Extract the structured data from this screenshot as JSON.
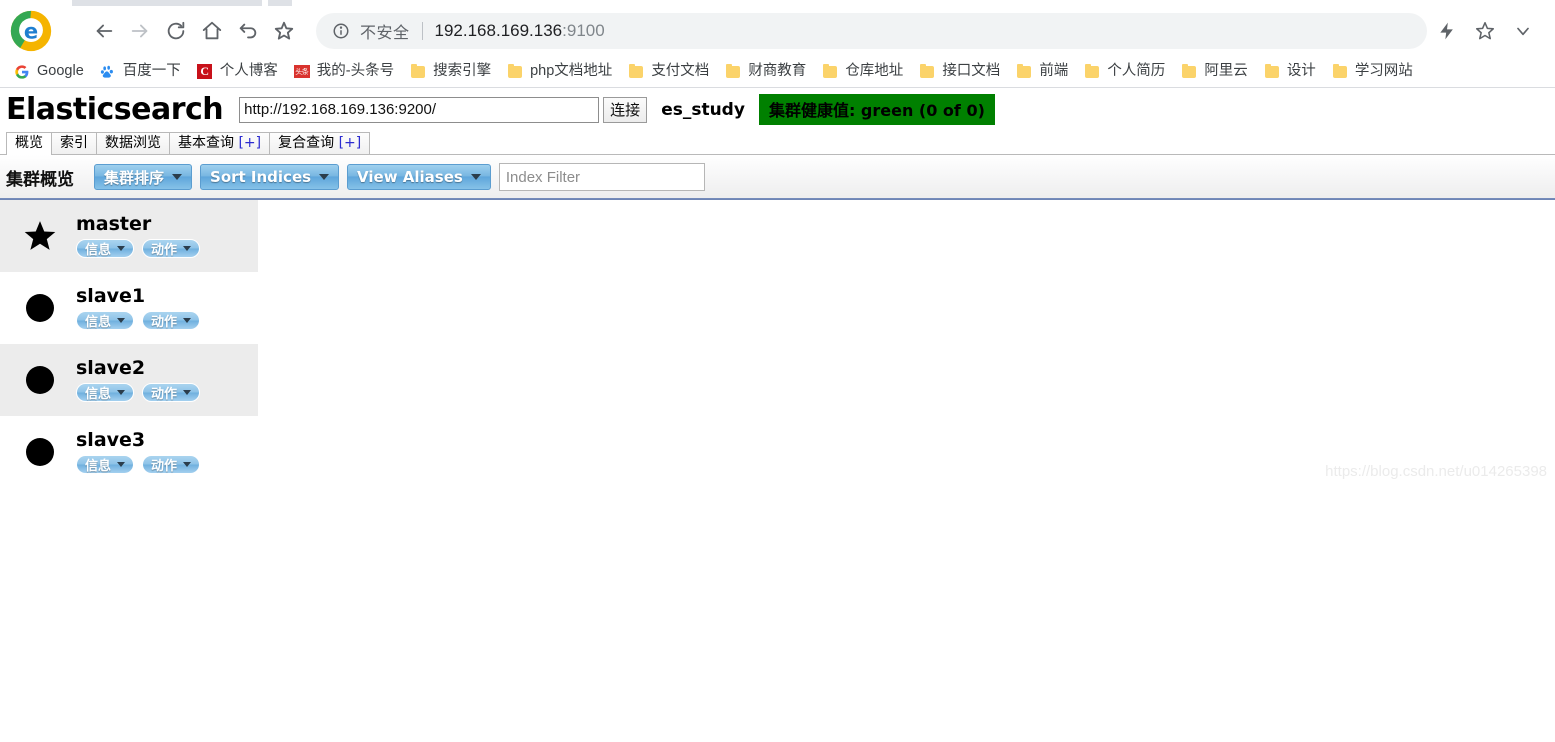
{
  "browser": {
    "nav": {
      "back_icon": "arrow-left-icon",
      "forward_icon": "arrow-right-icon",
      "reload_icon": "reload-icon",
      "home_icon": "home-icon",
      "history_back_icon": "undo-icon",
      "favorite_icon": "star-icon"
    },
    "omnibox": {
      "info_icon": "info-circle-icon",
      "security_label": "不安全",
      "url_host": "192.168.169.136",
      "url_port": ":9100"
    },
    "toolbar_right": {
      "flash_icon": "lightning-bolt-icon",
      "bookmark_icon": "star-outline-icon",
      "menu_icon": "chevron-down-icon"
    },
    "bookmarks": [
      {
        "label": "Google",
        "icon": "google-g-icon"
      },
      {
        "label": "百度一下",
        "icon": "baidu-paw-icon"
      },
      {
        "label": "个人博客",
        "icon": "csdn-c-icon"
      },
      {
        "label": "我的-头条号",
        "icon": "toutiao-icon"
      },
      {
        "label": "搜索引擎",
        "icon": "folder-icon"
      },
      {
        "label": "php文档地址",
        "icon": "folder-icon"
      },
      {
        "label": "支付文档",
        "icon": "folder-icon"
      },
      {
        "label": "财商教育",
        "icon": "folder-icon"
      },
      {
        "label": "仓库地址",
        "icon": "folder-icon"
      },
      {
        "label": "接口文档",
        "icon": "folder-icon"
      },
      {
        "label": "前端",
        "icon": "folder-icon"
      },
      {
        "label": "个人简历",
        "icon": "folder-icon"
      },
      {
        "label": "阿里云",
        "icon": "folder-icon"
      },
      {
        "label": "设计",
        "icon": "folder-icon"
      },
      {
        "label": "学习网站",
        "icon": "folder-icon"
      }
    ]
  },
  "app": {
    "title": "Elasticsearch",
    "connect": {
      "value": "http://192.168.169.136:9200/",
      "placeholder": "",
      "button_label": "连接"
    },
    "cluster_name": "es_study",
    "health": {
      "text": "集群健康值: green (0 of 0)",
      "color": "#008000"
    },
    "tabs": [
      {
        "label": "概览",
        "suffix": "",
        "active": true
      },
      {
        "label": "索引",
        "suffix": "",
        "active": false
      },
      {
        "label": "数据浏览",
        "suffix": "",
        "active": false
      },
      {
        "label": "基本查询",
        "suffix": "[+]",
        "active": false
      },
      {
        "label": "复合查询",
        "suffix": "[+]",
        "active": false
      }
    ],
    "subbar": {
      "title": "集群概览",
      "buttons": [
        {
          "label": "集群排序",
          "name": "cluster-sort-button"
        },
        {
          "label": "Sort Indices",
          "name": "sort-indices-button"
        },
        {
          "label": "View Aliases",
          "name": "view-aliases-button"
        }
      ],
      "index_filter_placeholder": "Index Filter",
      "index_filter_value": ""
    },
    "nodes": [
      {
        "name": "master",
        "icon": "star-icon",
        "is_master": true,
        "info_label": "信息",
        "action_label": "动作"
      },
      {
        "name": "slave1",
        "icon": "circle-icon",
        "is_master": false,
        "info_label": "信息",
        "action_label": "动作"
      },
      {
        "name": "slave2",
        "icon": "circle-icon",
        "is_master": false,
        "info_label": "信息",
        "action_label": "动作"
      },
      {
        "name": "slave3",
        "icon": "circle-icon",
        "is_master": false,
        "info_label": "信息",
        "action_label": "动作"
      }
    ],
    "watermark": "https://blog.csdn.net/u014265398"
  }
}
